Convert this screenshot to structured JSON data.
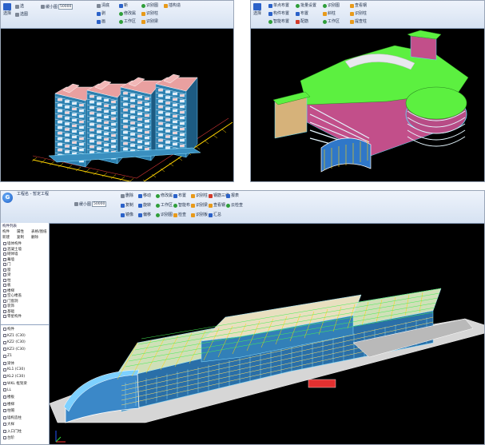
{
  "shot1": {
    "tools": {
      "row1": [
        "选择",
        "楼层",
        "区域",
        "量",
        "切",
        "撤",
        "布",
        "识别",
        "单",
        "工"
      ],
      "scale_label": "缓小图",
      "scale_value": "50000",
      "buttons": [
        {
          "label": "清底",
          "icon": "gray"
        },
        {
          "label": "剥",
          "icon": "blue"
        },
        {
          "label": "画",
          "icon": "blue"
        },
        {
          "label": "新",
          "icon": "blue"
        },
        {
          "label": "修改属",
          "icon": "green"
        },
        {
          "label": "工作区",
          "icon": "green"
        },
        {
          "label": "识别图",
          "icon": "green"
        },
        {
          "label": "识别柱",
          "icon": "orange"
        },
        {
          "label": "识别梁",
          "icon": "orange"
        },
        {
          "label": "插构造",
          "icon": "orange"
        }
      ],
      "left_col": [
        "选",
        "选择",
        "选图"
      ],
      "close_label": "墙"
    }
  },
  "shot2": {
    "tools": {
      "buttons": [
        {
          "label": "单点布置",
          "icon": "blue"
        },
        {
          "label": "构件布置",
          "icon": "blue"
        },
        {
          "label": "智能布置",
          "icon": "green"
        },
        {
          "label": "批量设置",
          "icon": "green"
        },
        {
          "label": "布置",
          "icon": "blue"
        },
        {
          "label": "配筋",
          "icon": "red"
        },
        {
          "label": "识别图",
          "icon": "green"
        },
        {
          "label": "斜柱",
          "icon": "orange"
        },
        {
          "label": "工作区",
          "icon": "green"
        },
        {
          "label": "查看钢",
          "icon": "orange"
        },
        {
          "label": "识别柱",
          "icon": "orange"
        },
        {
          "label": "提查柱",
          "icon": "orange"
        }
      ],
      "left_col": [
        "选择"
      ]
    }
  },
  "shot3": {
    "title": "工程名 - 暂定工程",
    "tabs": [
      "构件",
      "属性",
      "表格/图纸"
    ],
    "panel_title": "构件列表",
    "panel_toolbar": [
      "新建",
      "复制",
      "删除"
    ],
    "tree": [
      "墙体构件",
      "混凝土墙",
      "砌体墙",
      "幕墙",
      "门",
      "窗",
      "梁",
      "柱",
      "板",
      "楼梯",
      "空心楼盖",
      "门窗洞",
      "装饰",
      "基础",
      "零星构件"
    ],
    "tree2": [
      "构件",
      "KZ1 (C30)",
      "KZ2 (C30)",
      "KZ3 (C30)",
      "Z1",
      "梁体",
      "KL1 (C30)",
      "KL2 (C30)",
      "WKL 框架梁",
      "LL",
      "楼板",
      "楼梯",
      "柱帽",
      "墙构造柱",
      "大样",
      "入口门柱",
      "台阶"
    ],
    "ribbon_groups": [
      "工程",
      "绘图",
      "修改",
      "构件",
      "工程量",
      "识别",
      "钢筋",
      "视图",
      "工具"
    ],
    "scale_label": "缓小图",
    "scale_value": "50000",
    "buttons": [
      {
        "label": "删除",
        "icon": "gray"
      },
      {
        "label": "复制",
        "icon": "blue"
      },
      {
        "label": "镜像",
        "icon": "blue"
      },
      {
        "label": "移动",
        "icon": "blue"
      },
      {
        "label": "旋转",
        "icon": "blue"
      },
      {
        "label": "偏移",
        "icon": "blue"
      },
      {
        "label": "修改属",
        "icon": "green"
      },
      {
        "label": "工作区",
        "icon": "green"
      },
      {
        "label": "识别图",
        "icon": "green"
      },
      {
        "label": "布置",
        "icon": "blue"
      },
      {
        "label": "智能布",
        "icon": "green"
      },
      {
        "label": "检查",
        "icon": "orange"
      },
      {
        "label": "识别柱",
        "icon": "orange"
      },
      {
        "label": "识别梁",
        "icon": "orange"
      },
      {
        "label": "识别板",
        "icon": "orange"
      },
      {
        "label": "钢筋三维",
        "icon": "red"
      },
      {
        "label": "查看钢",
        "icon": "orange"
      },
      {
        "label": "汇总",
        "icon": "blue"
      },
      {
        "label": "报表",
        "icon": "blue"
      },
      {
        "label": "云检查",
        "icon": "green"
      }
    ]
  }
}
